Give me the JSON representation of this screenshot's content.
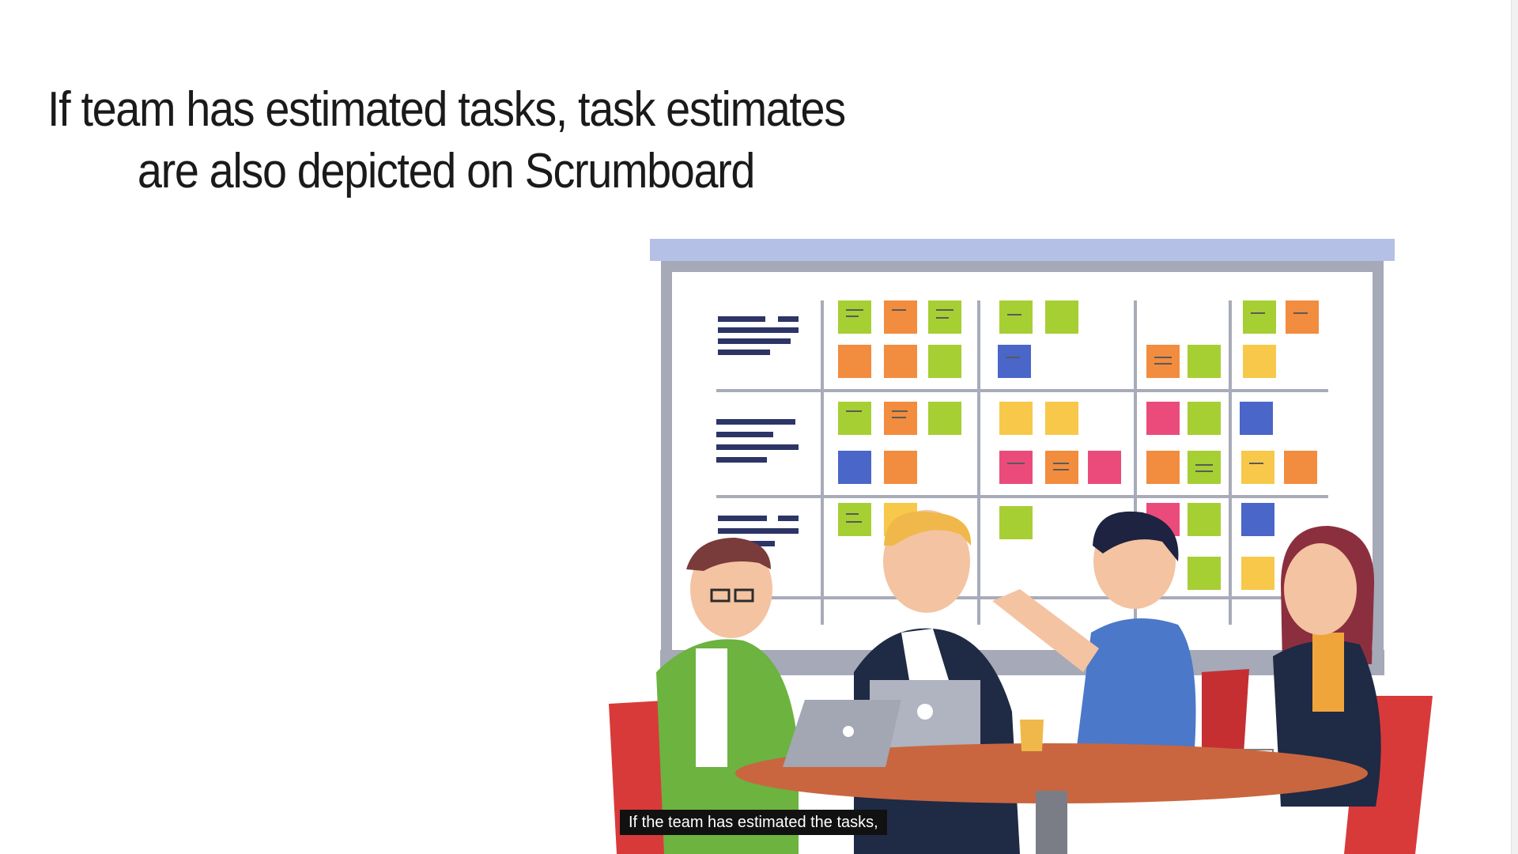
{
  "slide": {
    "title_line_1": "If team has estimated tasks, task estimates",
    "title_line_2": "are also depicted on Scrumboard"
  },
  "illustration": {
    "subject": "team-meeting-scrumboard",
    "colors": {
      "board_frame": "#a6a9b8",
      "board_top": "#b4c0e6",
      "board_surface": "#ffffff",
      "row_lines": "#2c3566",
      "note_green": "#a6cf34",
      "note_orange": "#f28c3e",
      "note_blue": "#4a66c9",
      "note_yellow": "#f7c84a",
      "note_pink": "#ea4b7b",
      "chair": "#d83a3a",
      "table": "#c9663f"
    }
  },
  "subtitle": {
    "text": "If the team has estimated the tasks,"
  }
}
